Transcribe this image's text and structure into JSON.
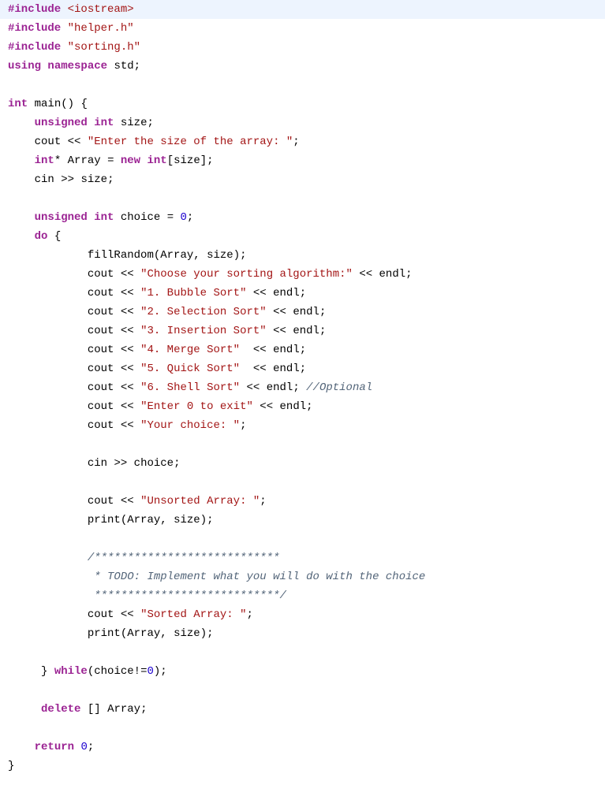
{
  "code": {
    "kw_include": "#include",
    "inc_iostream": "<iostream>",
    "inc_helper": "\"helper.h\"",
    "inc_sorting": "\"sorting.h\"",
    "kw_using": "using",
    "kw_namespace": "namespace",
    "std": "std",
    "semi": ";",
    "kw_int": "int",
    "main": "main",
    "lparen": "(",
    "rparen": ")",
    "lbrace": "{",
    "rbrace": "}",
    "kw_unsigned": "unsigned",
    "size": "size",
    "cout": "cout",
    "lshift": "<<",
    "str_enter_size": "\"Enter the size of the array: \"",
    "star": "*",
    "Array": "Array",
    "eq": "=",
    "kw_new": "new",
    "lbracket": "[",
    "rbracket": "]",
    "cin": "cin",
    "rshift": ">>",
    "choice": "choice",
    "zero": "0",
    "kw_do": "do",
    "fillRandom": "fillRandom",
    "comma": ",",
    "str_choose": "\"Choose your sorting algorithm:\"",
    "endl": "endl",
    "str_1": "\"1. Bubble Sort\"",
    "str_2": "\"2. Selection Sort\"",
    "str_3": "\"3. Insertion Sort\"",
    "str_4": "\"4. Merge Sort\"",
    "str_5": "\"5. Quick Sort\"",
    "str_6": "\"6. Shell Sort\"",
    "cmt_optional": "//Optional",
    "str_exit": "\"Enter 0 to exit\"",
    "str_your_choice": "\"Your choice: \"",
    "str_unsorted": "\"Unsorted Array: \"",
    "print": "print",
    "cmt_block1": "/****************************",
    "cmt_block2": " * TODO: Implement what you will do with the choice",
    "cmt_block3": " ****************************/",
    "str_sorted": "\"Sorted Array: \"",
    "kw_while": "while",
    "neq": "!=",
    "kw_delete": "delete",
    "kw_return": "return"
  }
}
